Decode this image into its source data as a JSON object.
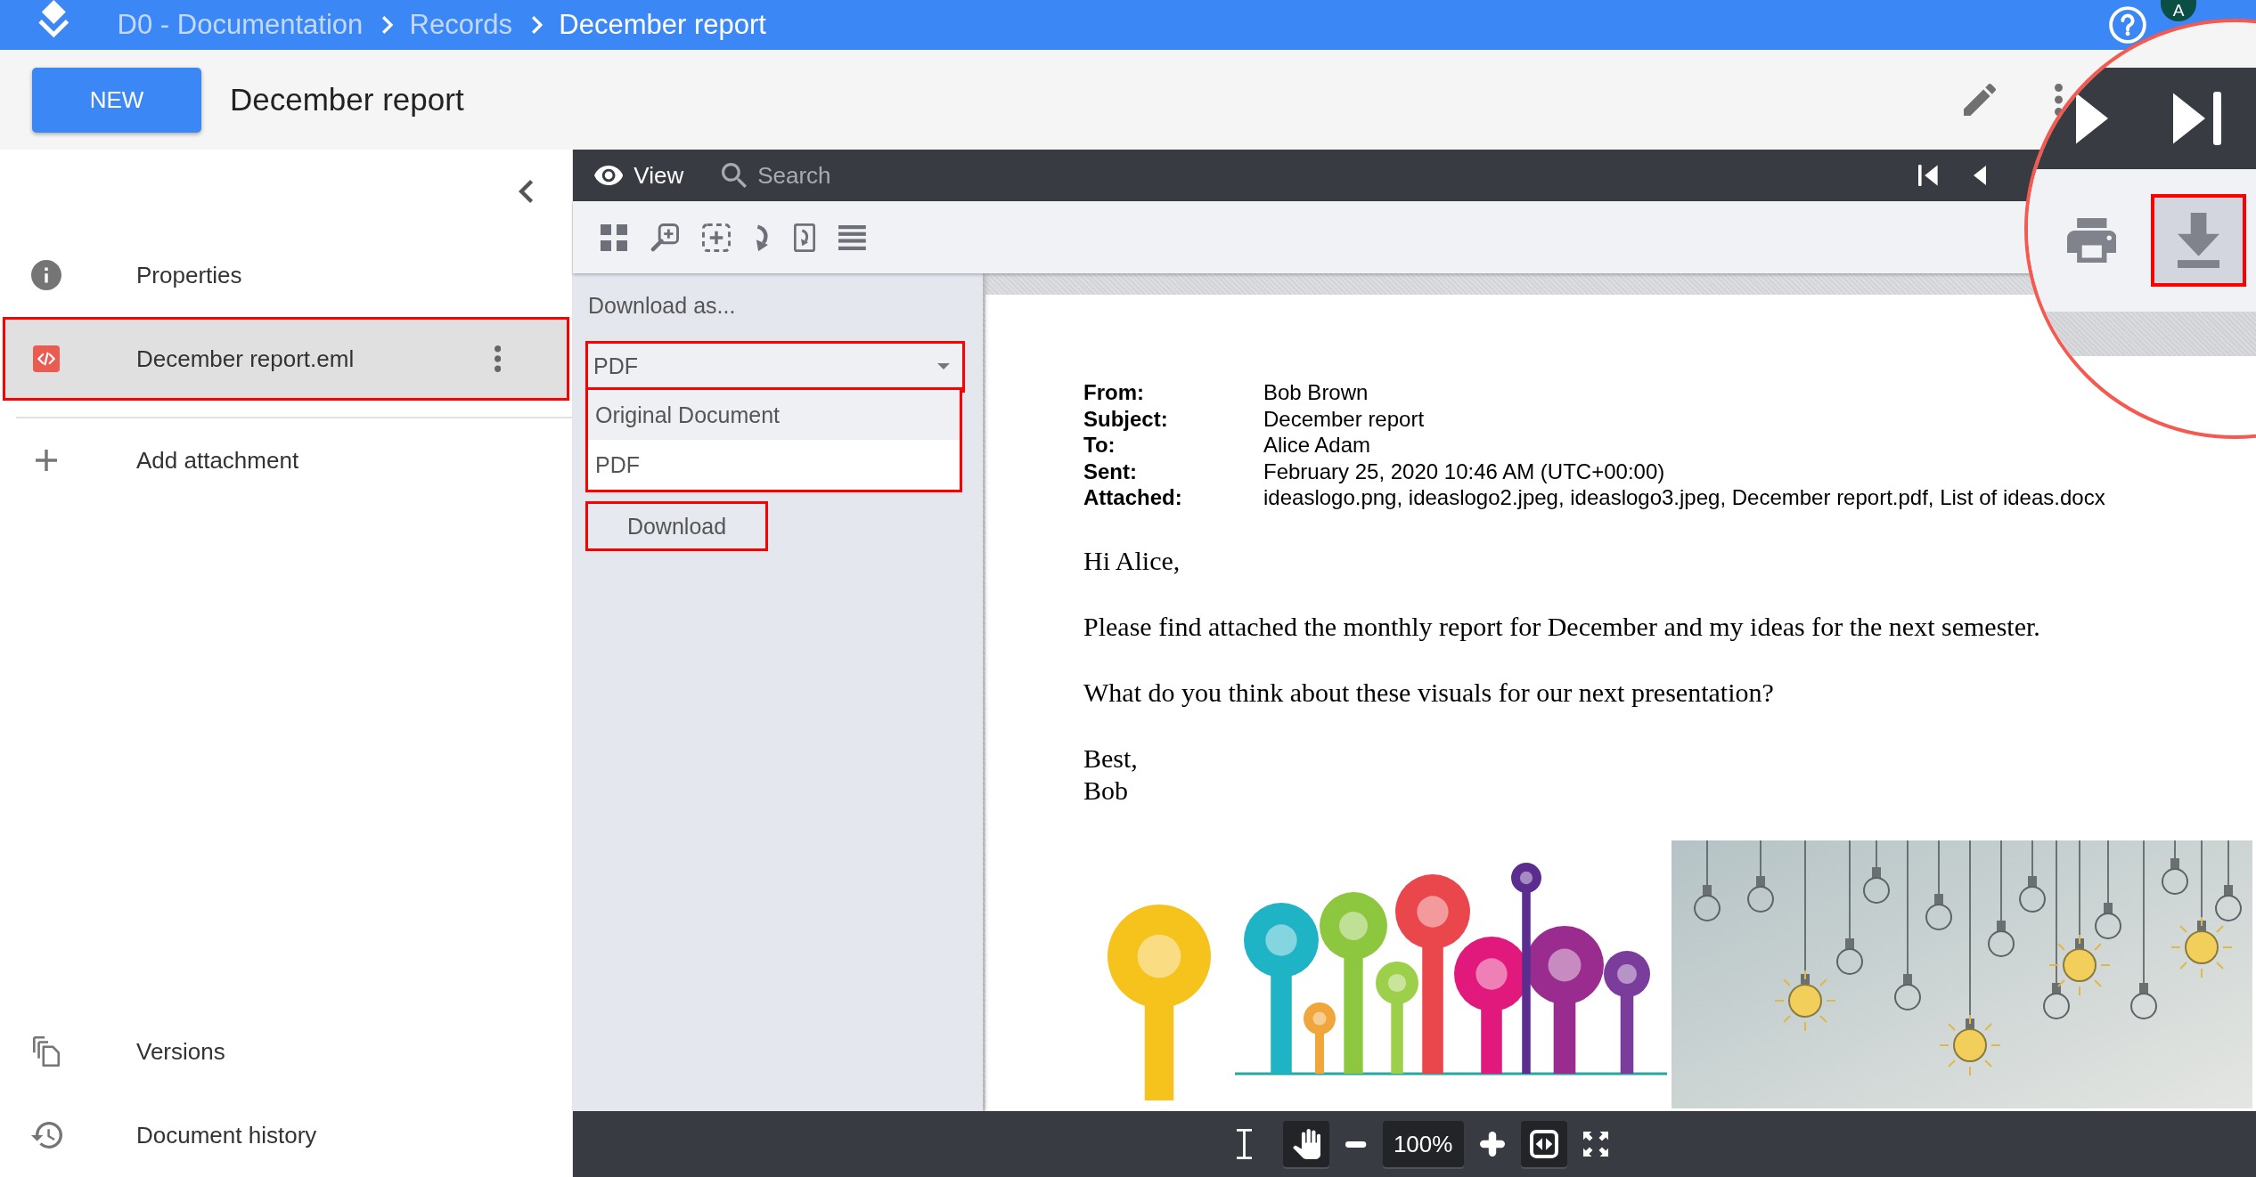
{
  "top_bar": {
    "breadcrumb": [
      {
        "label": "D0 - Documentation",
        "current": false
      },
      {
        "label": "Records",
        "current": false
      },
      {
        "label": "December report",
        "current": true
      }
    ],
    "avatar": "A"
  },
  "header": {
    "new_button": "NEW",
    "title": "December report"
  },
  "sidebar": {
    "items": [
      {
        "kind": "info",
        "label": "Properties",
        "selected": false,
        "highlighted": false
      },
      {
        "kind": "file",
        "label": "December report.eml",
        "selected": true,
        "highlighted": true
      },
      {
        "kind": "add",
        "label": "Add attachment",
        "selected": false,
        "highlighted": false
      }
    ],
    "footer_items": [
      {
        "kind": "versions",
        "label": "Versions"
      },
      {
        "kind": "history",
        "label": "Document history"
      }
    ]
  },
  "viewer": {
    "tabs": [
      {
        "kind": "view",
        "label": "View",
        "selected": true
      },
      {
        "kind": "search",
        "label": "Search",
        "selected": false
      }
    ],
    "nav_buttons": [
      {
        "kind": "first"
      },
      {
        "kind": "previous"
      }
    ],
    "tools": [
      {
        "kind": "thumbnails"
      },
      {
        "kind": "zoom"
      },
      {
        "kind": "marquee-zoom"
      },
      {
        "kind": "rotate"
      },
      {
        "kind": "rotate-page"
      },
      {
        "kind": "menu"
      }
    ]
  },
  "download_panel": {
    "heading": "Download as...",
    "format": {
      "value": "PDF",
      "highlighted": true
    },
    "options_highlighted": true,
    "options": [
      {
        "label": "Original Document",
        "hovered": true
      },
      {
        "label": "PDF",
        "hovered": false
      }
    ],
    "button": {
      "label": "Download",
      "highlighted": true
    }
  },
  "document": {
    "fields": [
      {
        "label": "From:",
        "value": "Bob Brown"
      },
      {
        "label": "Subject:",
        "value": "December report"
      },
      {
        "label": "To:",
        "value": "Alice Adam"
      },
      {
        "label": "Sent:",
        "value": "February 25, 2020 10:46 AM (UTC+00:00)"
      },
      {
        "label": "Attached:",
        "value": "ideaslogo.png, ideaslogo2.jpeg, ideaslogo3.jpeg, December report.pdf, List of ideas.docx"
      }
    ],
    "paragraphs": [
      [
        "Hi Alice,"
      ],
      [
        "Please find attached the monthly report for December and my ideas for the next semester."
      ],
      [
        "What do you think about these visuals for our next presentation?"
      ],
      [
        "Best,",
        "Bob"
      ]
    ],
    "images": [
      {
        "kind": "illustration"
      },
      {
        "kind": "photo"
      }
    ]
  },
  "bottom_toolbar": {
    "controls": [
      {
        "kind": "text-select",
        "selected": false
      },
      {
        "kind": "pan",
        "selected": true
      },
      {
        "kind": "zoom-out"
      },
      {
        "kind": "zoom-level",
        "label": "100%"
      },
      {
        "kind": "zoom-in"
      },
      {
        "kind": "fit-width",
        "selected": true
      },
      {
        "kind": "fullscreen"
      }
    ]
  },
  "magnifier": {
    "nav_buttons": [
      {
        "kind": "next"
      },
      {
        "kind": "last"
      }
    ],
    "tools": [
      {
        "kind": "print",
        "selected": false,
        "highlighted": false
      },
      {
        "kind": "download",
        "selected": true,
        "highlighted": true
      }
    ]
  }
}
